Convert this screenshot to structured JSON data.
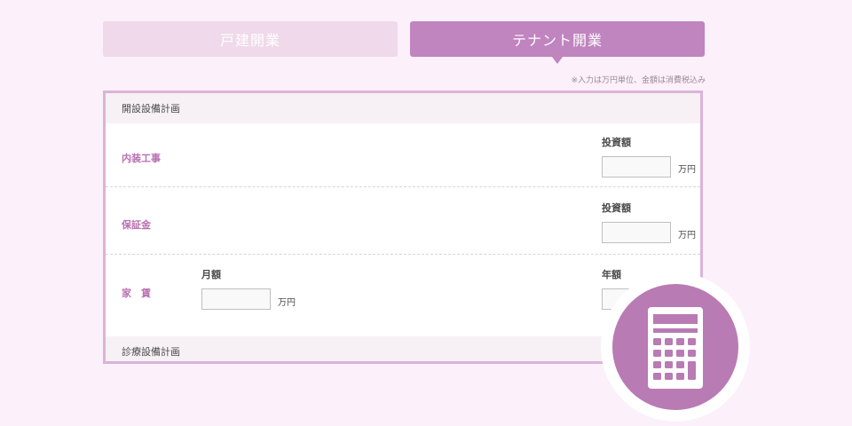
{
  "tabs": [
    {
      "label": "戸建開業",
      "active": false
    },
    {
      "label": "テナント開業",
      "active": true
    }
  ],
  "note": "※入力は万円単位、金額は消費税込み",
  "sections": {
    "opening": {
      "title": "開設設備計画"
    },
    "clinic": {
      "title": "診療設備計画"
    }
  },
  "rows": {
    "interior": {
      "label": "内装工事",
      "field_label": "投資額",
      "value": "",
      "unit": "万円"
    },
    "deposit": {
      "label": "保証金",
      "field_label": "投資額",
      "value": "",
      "unit": "万円"
    },
    "rent": {
      "label": "家　賃",
      "monthly_label": "月額",
      "monthly_value": "",
      "monthly_unit": "万円",
      "annual_label": "年額",
      "annual_value": ""
    }
  },
  "icons": {
    "calculator": "calculator-icon"
  },
  "colors": {
    "background": "#fcf0fa",
    "accent": "#c084bf",
    "tab_inactive": "#efd9ea",
    "label_purple": "#b86fb0",
    "panel_border": "#dbb3d8",
    "calculator_circle": "#b97bb4"
  }
}
